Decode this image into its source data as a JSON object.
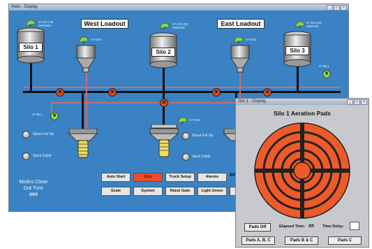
{
  "main_window": {
    "title": "Main - Display",
    "window_buttons": [
      "_",
      "□",
      "×"
    ],
    "west_loadout": "West Loadout",
    "east_loadout": "East Loadout",
    "silos": [
      {
        "label": "Silo 1",
        "tag": "47-DC1.08",
        "status": "Selected"
      },
      {
        "label": "Silo 2",
        "tag": "47-DC2.08",
        "status": "Selected"
      },
      {
        "label": "Silo 3",
        "tag": "47-DC3.08",
        "status": "Selected"
      }
    ],
    "dust_collector_tags": [
      "47-DC4",
      "47-DC5",
      "47-DC6"
    ],
    "bin_tags": [
      "47-BL1",
      "47-BL1"
    ],
    "spout_full_up": "Spout Full Up",
    "slack_cable": "Slack Cable",
    "modco_clean": "Modco Clean",
    "out_time": "Out Time",
    "out_time_value": "###",
    "hash_partial": "##",
    "buttons": {
      "auto_start": "Auto Start",
      "stop": "Stop",
      "truck_setup": "Truck Setup",
      "alarms": "Alarms",
      "scale": "Scale",
      "system": "System",
      "raise_gate": "Raise Gate",
      "light_green": "Light Green"
    }
  },
  "popup_window": {
    "title": "Silo 1 - Display",
    "heading": "Silo 1 Aeration Pads",
    "pads_off": "Pads Off",
    "elapsed_time_label": "Elapsed Time:",
    "elapsed_time_value": "##",
    "time_delay_label": "Time Delay:",
    "pads_abc": "Pads A, B, C",
    "pads_bc": "Pads B & C",
    "pads_c": "Pads C"
  },
  "colors": {
    "background": "#3a82c4",
    "pad": "#ee5a2a",
    "valve": "#e84d1d",
    "indicator": "#8bd35a"
  }
}
